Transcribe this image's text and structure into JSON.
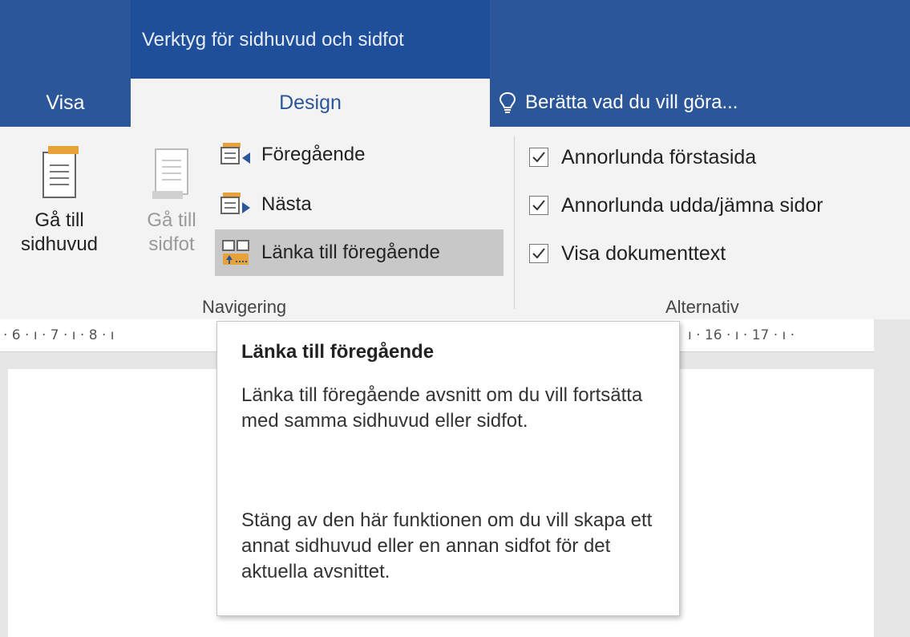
{
  "colors": {
    "accent": "#2b579a",
    "contextual": "#1f4e9b",
    "ribbon": "#f3f3f3",
    "hover": "#c8c8c8"
  },
  "contextual_tab": {
    "label": "Verktyg för sidhuvud och sidfot"
  },
  "tabs": {
    "visa": "Visa",
    "design": "Design"
  },
  "tell_me": {
    "icon": "lightbulb-icon",
    "text": "Berätta vad du vill göra..."
  },
  "navigation": {
    "goto_header": {
      "line1": "Gå till",
      "line2": "sidhuvud"
    },
    "goto_footer": {
      "line1": "Gå till",
      "line2": "sidfot"
    },
    "previous": "Föregående",
    "next": "Nästa",
    "link_previous": "Länka till föregående",
    "group_label": "Navigering"
  },
  "options": {
    "items": [
      {
        "label": "Annorlunda förstasida",
        "checked": true
      },
      {
        "label": "Annorlunda udda/jämna sidor",
        "checked": true
      },
      {
        "label": "Visa dokumenttext",
        "checked": true
      }
    ],
    "group_label": "Alternativ"
  },
  "ruler": {
    "left": "· 6 · ı · 7 · ı · 8 · ı",
    "right": "ı · 16 · ı · 17 · ı ·"
  },
  "tooltip": {
    "title": "Länka till föregående",
    "para1": "Länka till föregående avsnitt om du vill fortsätta med samma sidhuvud eller sidfot.",
    "para2": "Stäng av den här funktionen om du vill skapa ett annat sidhuvud eller en annan sidfot för det aktuella avsnittet."
  }
}
